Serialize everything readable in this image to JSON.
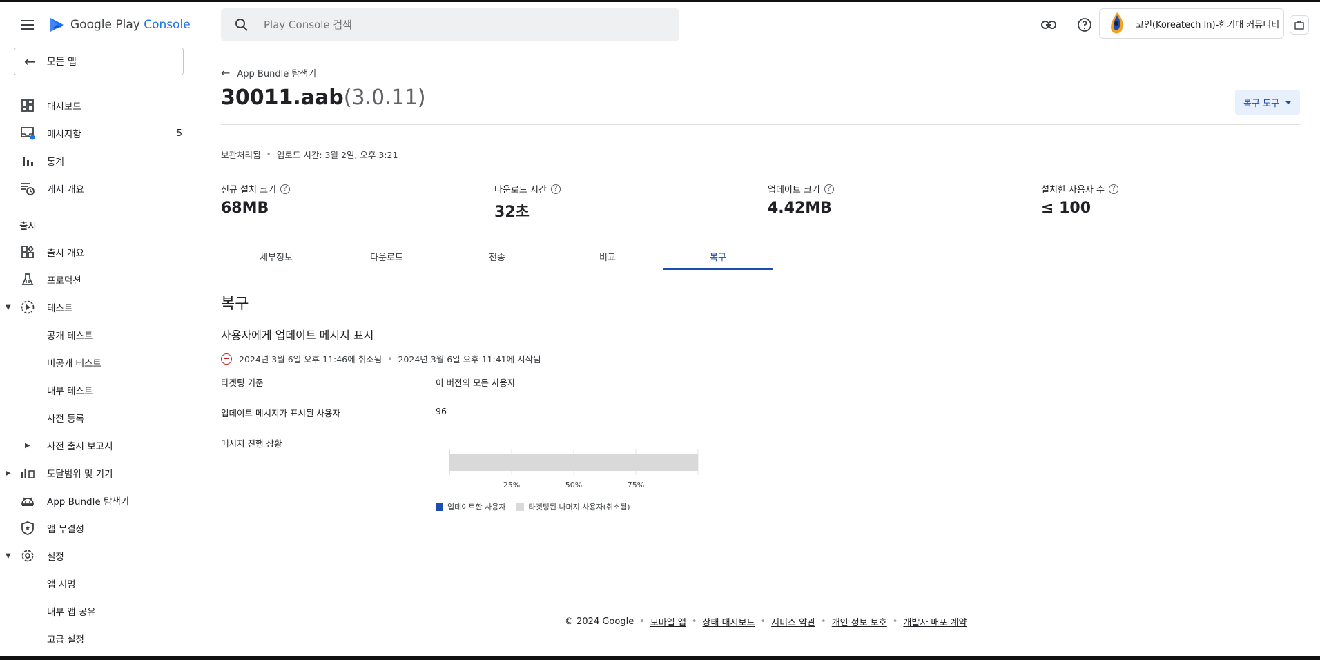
{
  "app": {
    "brand": "Google Play",
    "brand_suffix": "Console",
    "all_apps_label": "모든 앱"
  },
  "search": {
    "placeholder": "Play Console 검색"
  },
  "account": {
    "name": "코인(Koreatech In)-한기대 커뮤니티"
  },
  "sidebar": {
    "items": [
      {
        "label": "대시보드",
        "icon": "dashboard-icon"
      },
      {
        "label": "메시지함",
        "icon": "inbox-icon",
        "badge": "5"
      },
      {
        "label": "통계",
        "icon": "bar-chart-icon"
      },
      {
        "label": "게시 개요",
        "icon": "publishing-overview-icon"
      }
    ],
    "release_section": "출시",
    "release_items": [
      {
        "label": "출시 개요",
        "icon": "release-overview-icon"
      },
      {
        "label": "프로덕션",
        "icon": "production-icon"
      },
      {
        "label": "테스트",
        "icon": "test-icon"
      },
      {
        "label": "공개 테스트"
      },
      {
        "label": "비공개 테스트"
      },
      {
        "label": "내부 테스트"
      },
      {
        "label": "사전 등록"
      },
      {
        "label": "사전 출시 보고서"
      },
      {
        "label": "도달범위 및 기기",
        "icon": "reach-devices-icon"
      },
      {
        "label": "App Bundle 탐색기",
        "icon": "android-icon"
      },
      {
        "label": "앱 무결성",
        "icon": "shield-icon"
      },
      {
        "label": "설정",
        "icon": "gear-icon"
      },
      {
        "label": "앱 서명"
      },
      {
        "label": "내부 앱 공유"
      },
      {
        "label": "고급 설정"
      }
    ]
  },
  "page": {
    "breadcrumb": "App Bundle 탐색기",
    "title": "30011.aab",
    "version": "(3.0.11)",
    "restore_tool": "복구 도구",
    "status": "보관처리됨",
    "upload_time": "업로드 시간: 3월 2일, 오후 3:21",
    "stats": [
      {
        "label": "신규 설치 크기",
        "value": "68MB"
      },
      {
        "label": "다운로드 시간",
        "value": "32초"
      },
      {
        "label": "업데이트 크기",
        "value": "4.42MB"
      },
      {
        "label": "설치한 사용자 수",
        "value": "≤ 100"
      }
    ],
    "tabs": [
      "세부정보",
      "다운로드",
      "전송",
      "비교",
      "복구"
    ],
    "active_tab": "복구",
    "section_title": "복구",
    "subsection_title": "사용자에게 업데이트 메시지 표시",
    "event_cancelled": "2024년 3월 6일 오후 11:46에 취소됨",
    "event_started": "2024년 3월 6일 오후 11:41에 시작됨",
    "targeting_label": "타겟팅 기준",
    "targeting_value": "이 버전의 모든 사용자",
    "users_label": "업데이트 메시지가 표시된 사용자",
    "users_value": "96",
    "progress_label": "메시지 진행 상황"
  },
  "chart_data": {
    "type": "bar",
    "orientation": "horizontal",
    "stacked": true,
    "tick_labels": [
      "25%",
      "50%",
      "75%"
    ],
    "xlim": [
      0,
      100
    ],
    "series": [
      {
        "name": "업데이트한 사용자",
        "values": [
          0
        ],
        "color": "#1a4eb0"
      },
      {
        "name": "타겟팅된 나머지 사용자(취소됨)",
        "values": [
          100
        ],
        "color": "#d9d9d9"
      }
    ],
    "grid": true,
    "legend": "bottom"
  },
  "footer": {
    "copyright": "© 2024 Google",
    "links": [
      "모바일 앱",
      "상태 대시보드",
      "서비스 약관",
      "개인 정보 보호",
      "개발자 배포 계약"
    ]
  }
}
